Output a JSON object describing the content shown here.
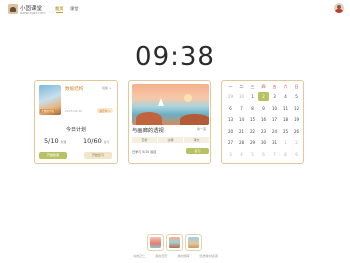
{
  "header": {
    "brand": "小固课堂",
    "url": "www.xgkt.com",
    "nav": [
      {
        "label": "首页",
        "active": true
      },
      {
        "label": "课堂",
        "active": false
      }
    ]
  },
  "clock": {
    "time": "09:38"
  },
  "study_card": {
    "title": "数据结构",
    "switch_label": "切换 >",
    "cover_tag": "大数据学院",
    "date": "2025.09.10",
    "badge": "进行中 >",
    "plan_title": "今日计划",
    "stat_1": {
      "value": "5/10",
      "unit": "新课"
    },
    "stat_2": {
      "value": "10/60",
      "unit": "复习"
    },
    "btn_1": "开始新课",
    "btn_2": "开始复习"
  },
  "poem_card": {
    "title": "与画廊的透视",
    "switch_label": "换一首",
    "tabs": [
      "赏析",
      "注释",
      "译文"
    ],
    "meta": "已学习 5/10 篇目",
    "button": "复习",
    "colors": {
      "accent": "#b9c263"
    }
  },
  "calendar": {
    "weekdays": [
      "一",
      "二",
      "三",
      "四",
      "五",
      "六",
      "日"
    ],
    "weekend_indices": [
      3,
      4,
      5,
      6
    ],
    "days": [
      {
        "d": "29",
        "other": true
      },
      {
        "d": "30",
        "other": true
      },
      {
        "d": "1"
      },
      {
        "d": "2",
        "today": true
      },
      {
        "d": "3"
      },
      {
        "d": "4"
      },
      {
        "d": "5"
      },
      {
        "d": "6"
      },
      {
        "d": "7"
      },
      {
        "d": "8"
      },
      {
        "d": "9"
      },
      {
        "d": "10"
      },
      {
        "d": "11"
      },
      {
        "d": "12"
      },
      {
        "d": "13"
      },
      {
        "d": "14"
      },
      {
        "d": "15"
      },
      {
        "d": "16"
      },
      {
        "d": "17"
      },
      {
        "d": "18"
      },
      {
        "d": "19"
      },
      {
        "d": "20"
      },
      {
        "d": "21"
      },
      {
        "d": "22"
      },
      {
        "d": "23"
      },
      {
        "d": "24"
      },
      {
        "d": "25"
      },
      {
        "d": "26"
      },
      {
        "d": "27"
      },
      {
        "d": "28"
      },
      {
        "d": "29"
      },
      {
        "d": "30"
      },
      {
        "d": "31"
      },
      {
        "d": "1",
        "other": true
      },
      {
        "d": "2",
        "other": true
      },
      {
        "d": "3",
        "other": true
      },
      {
        "d": "4",
        "other": true
      },
      {
        "d": "5",
        "other": true
      },
      {
        "d": "6",
        "other": true
      },
      {
        "d": "7",
        "other": true
      },
      {
        "d": "8",
        "other": true
      },
      {
        "d": "9",
        "other": true
      }
    ]
  },
  "dock": {
    "items": [
      "books-app-icon",
      "poem-app-icon",
      "calendar-app-icon"
    ],
    "labels": [
      "书的正仁",
      "我的日历",
      "我的题库",
      "优质素材资源"
    ]
  }
}
